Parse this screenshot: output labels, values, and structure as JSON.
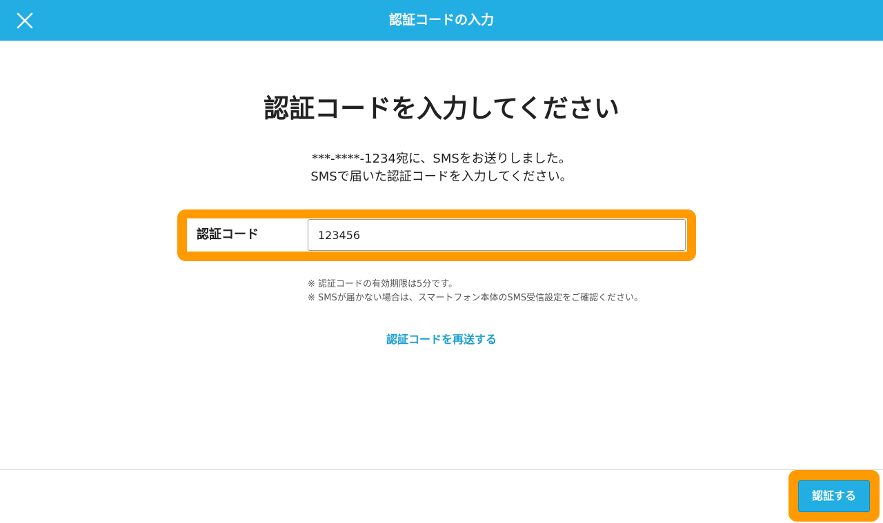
{
  "header": {
    "title": "認証コードの入力",
    "close_icon": "close-icon"
  },
  "main": {
    "heading": "認証コードを入力してください",
    "instruction_line1": "***-****-1234宛に、SMSをお送りしました。",
    "instruction_line2": "SMSで届いた認証コードを入力してください。",
    "form": {
      "label": "認証コード",
      "value": "123456"
    },
    "note_line1": "※ 認証コードの有効期限は5分です。",
    "note_line2": "※ SMSが届かない場合は、スマートフォン本体のSMS受信設定をご確認ください。",
    "resend_label": "認証コードを再送する"
  },
  "footer": {
    "submit_label": "認証する"
  },
  "colors": {
    "header_bg": "#22aee3",
    "highlight": "#ff9a00",
    "link": "#1a9fd0"
  }
}
